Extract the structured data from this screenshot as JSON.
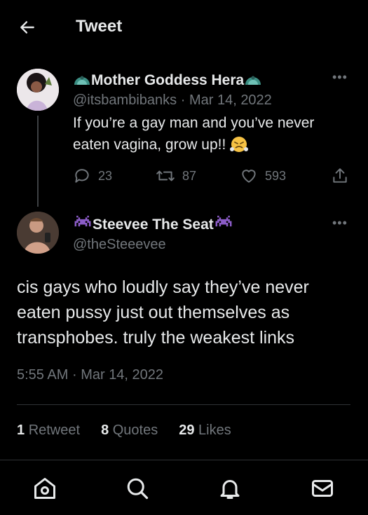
{
  "header": {
    "title": "Tweet",
    "back_icon": "arrow-left-icon"
  },
  "tweet1": {
    "display_name": "Mother Goddess Hera",
    "name_emoji": "peacock-emoji",
    "handle": "@itsbambibanks",
    "separator": "·",
    "date": "Mar 14, 2022",
    "text": "If you’re a gay man and you’ve never eaten vagina, grow up!!",
    "text_emoji": "face-with-steam-emoji",
    "replies": "23",
    "retweets": "87",
    "likes": "593"
  },
  "tweet2": {
    "display_name": "Steevee The Seat",
    "name_emoji": "space-invader-emoji",
    "handle": "@theSteeevee",
    "text": "cis gays who loudly say they’ve never eaten pussy just out themselves as transphobes. truly the weakest links",
    "time": "5:55 AM",
    "separator": "·",
    "date": "Mar 14, 2022",
    "retweet_count": "1",
    "retweet_label": "Retweet",
    "quote_count": "8",
    "quote_label": "Quotes",
    "like_count": "29",
    "like_label": "Likes"
  },
  "nav": {
    "items": [
      "home-icon",
      "search-icon",
      "notifications-icon",
      "messages-icon"
    ]
  },
  "colors": {
    "background": "#000000",
    "text": "#e7e9ea",
    "muted": "#71767b",
    "divider": "#2f3336"
  }
}
